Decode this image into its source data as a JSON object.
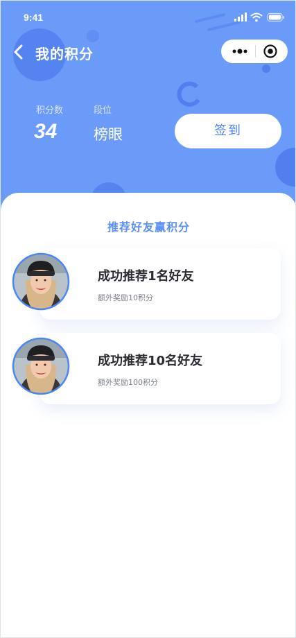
{
  "status_bar": {
    "time": "9:41",
    "signal_icon": "signal-icon",
    "wifi_icon": "wifi-icon",
    "battery_icon": "battery-icon"
  },
  "nav": {
    "title": "我的积分",
    "back_icon": "back-icon",
    "more_icon": "more-dots-icon",
    "close_icon": "close-circle-icon"
  },
  "stats": {
    "points_label": "积分数",
    "points_value": "34",
    "rank_label": "段位",
    "rank_value": "榜眼"
  },
  "checkin_button": {
    "label": "签到"
  },
  "section": {
    "title": "推荐好友赢积分"
  },
  "rewards": [
    {
      "title": "成功推荐1名好友",
      "subtitle": "额外奖励10积分"
    },
    {
      "title": "成功推荐10名好友",
      "subtitle": "额外奖励100积分"
    }
  ],
  "colors": {
    "header_bg": "#6a9bf9",
    "accent": "#4d7ff2",
    "section_title": "#5a8ff6",
    "avatar_border": "#4c86f6"
  }
}
